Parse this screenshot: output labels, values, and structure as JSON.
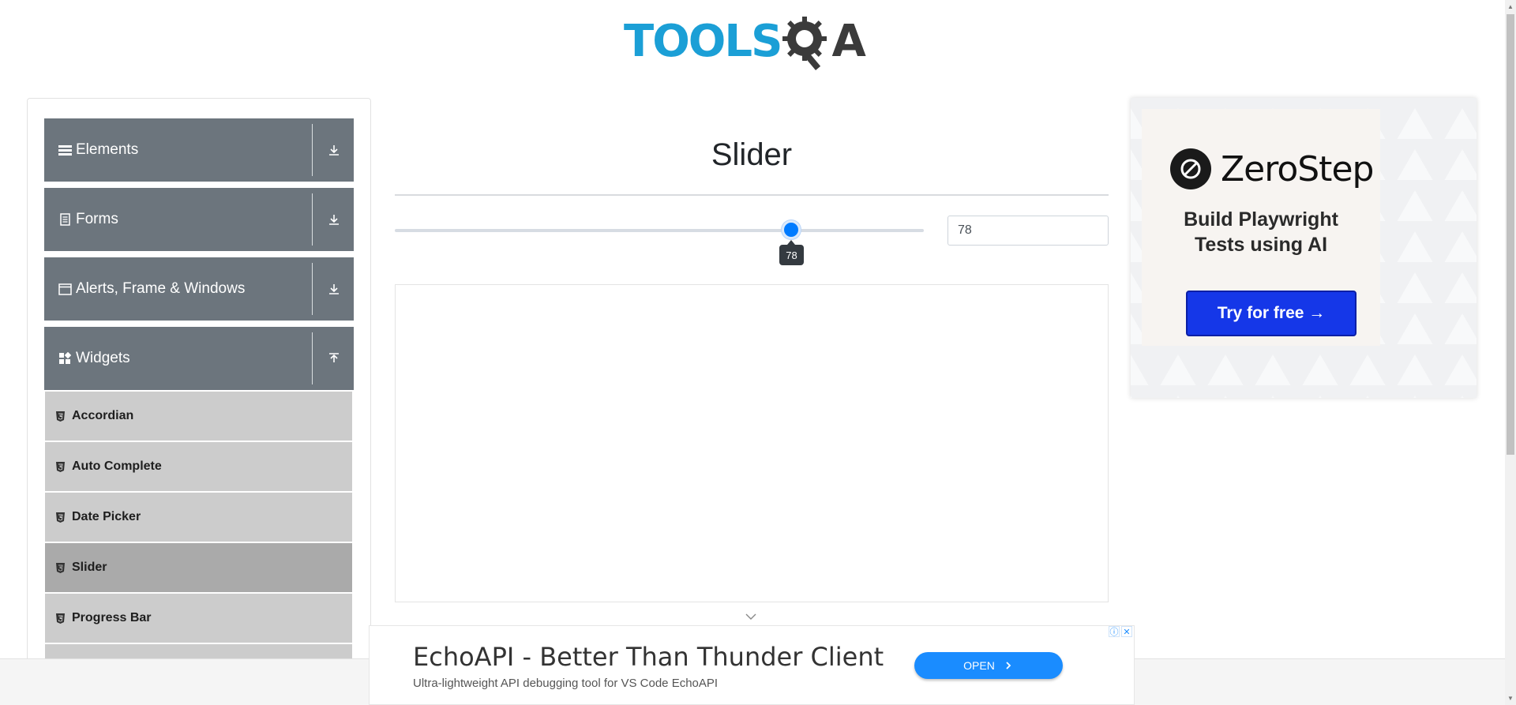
{
  "logo": {
    "text_tools": "TOOLS",
    "text_qa": "A"
  },
  "sidebar": {
    "groups": [
      {
        "label": "Elements",
        "icon": "menu-icon",
        "arrow": "download-arrow-icon"
      },
      {
        "label": "Forms",
        "icon": "document-icon",
        "arrow": "download-arrow-icon"
      },
      {
        "label": "Alerts, Frame & Windows",
        "icon": "window-icon",
        "arrow": "download-arrow-icon"
      },
      {
        "label": "Widgets",
        "icon": "widgets-icon",
        "arrow": "upload-arrow-icon"
      }
    ],
    "items": [
      {
        "label": "Accordian",
        "active": false
      },
      {
        "label": "Auto Complete",
        "active": false
      },
      {
        "label": "Date Picker",
        "active": false
      },
      {
        "label": "Slider",
        "active": true
      },
      {
        "label": "Progress Bar",
        "active": false
      }
    ]
  },
  "main": {
    "title": "Slider",
    "slider": {
      "value": 78,
      "min": 0,
      "max": 100,
      "tooltip": "78",
      "field_value": "78"
    }
  },
  "ad_right": {
    "brand": "ZeroStep",
    "headline_line1": "Build Playwright",
    "headline_line2": "Tests using AI",
    "cta": "Try for free →"
  },
  "ad_bottom": {
    "title": "EchoAPI - Better Than Thunder Client",
    "subtitle": "Ultra-lightweight API debugging tool for VS Code EchoAPI",
    "open": "OPEN"
  },
  "colors": {
    "accent": "#007bff",
    "sidebar_header": "#6c757d",
    "menu_item": "#cccccc",
    "menu_active": "#aaaaaa",
    "logo_blue": "#1b9fd6"
  }
}
